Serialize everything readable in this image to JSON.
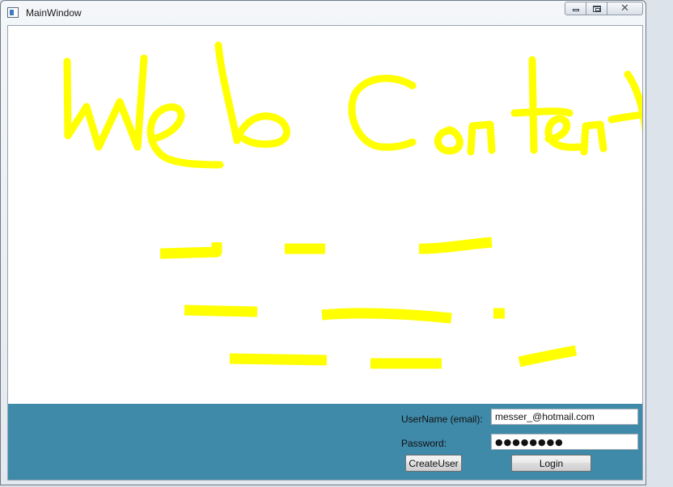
{
  "window": {
    "title": "MainWindow",
    "icon": "app-window-icon",
    "caption_buttons": [
      "minimize-icon",
      "maximize-icon",
      "close-icon"
    ]
  },
  "web_content": {
    "drawing_color": "#ffff00",
    "handwritten_text": "Web Content"
  },
  "login": {
    "panel_color": "#3f89a9",
    "username_label": "UserName (email):",
    "username_value": "messer_@hotmail.com",
    "password_label": "Password:",
    "password_value": "●●●●●●●●",
    "create_user_label": "CreateUser",
    "login_label": "Login"
  }
}
